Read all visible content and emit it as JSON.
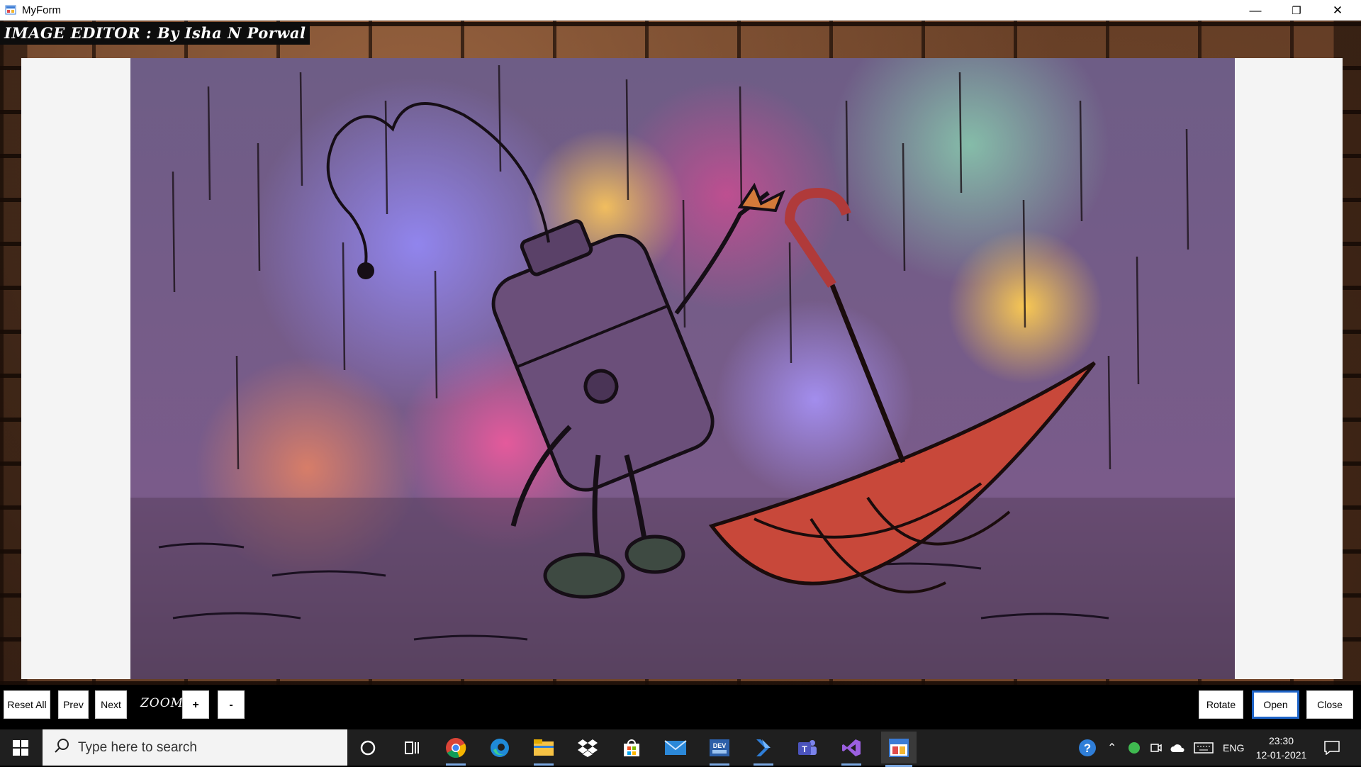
{
  "window": {
    "title": "MyForm",
    "controls": {
      "minimize": "—",
      "restore": "❐",
      "close": "✕"
    }
  },
  "header": {
    "label": "IMAGE EDITOR : By Isha N Porwal"
  },
  "picture": {
    "icon": "image-viewer-photo"
  },
  "toolbar": {
    "reset_all": "Reset All",
    "prev": "Prev",
    "next": "Next",
    "zoom_label": "ZOOM",
    "zoom_in": "+",
    "zoom_out": "-",
    "rotate": "Rotate",
    "open": "Open",
    "close": "Close"
  },
  "taskbar": {
    "search_placeholder": "Type here to search",
    "apps": [
      "cortana",
      "task-view",
      "chrome",
      "edge",
      "file-explorer",
      "dropbox",
      "microsoft-store",
      "mail",
      "dev-app",
      "power-automate",
      "teams",
      "visual-studio",
      "myform"
    ],
    "tray": {
      "language": "ENG"
    },
    "clock": {
      "time": "23:30",
      "date": "12-01-2021"
    }
  }
}
